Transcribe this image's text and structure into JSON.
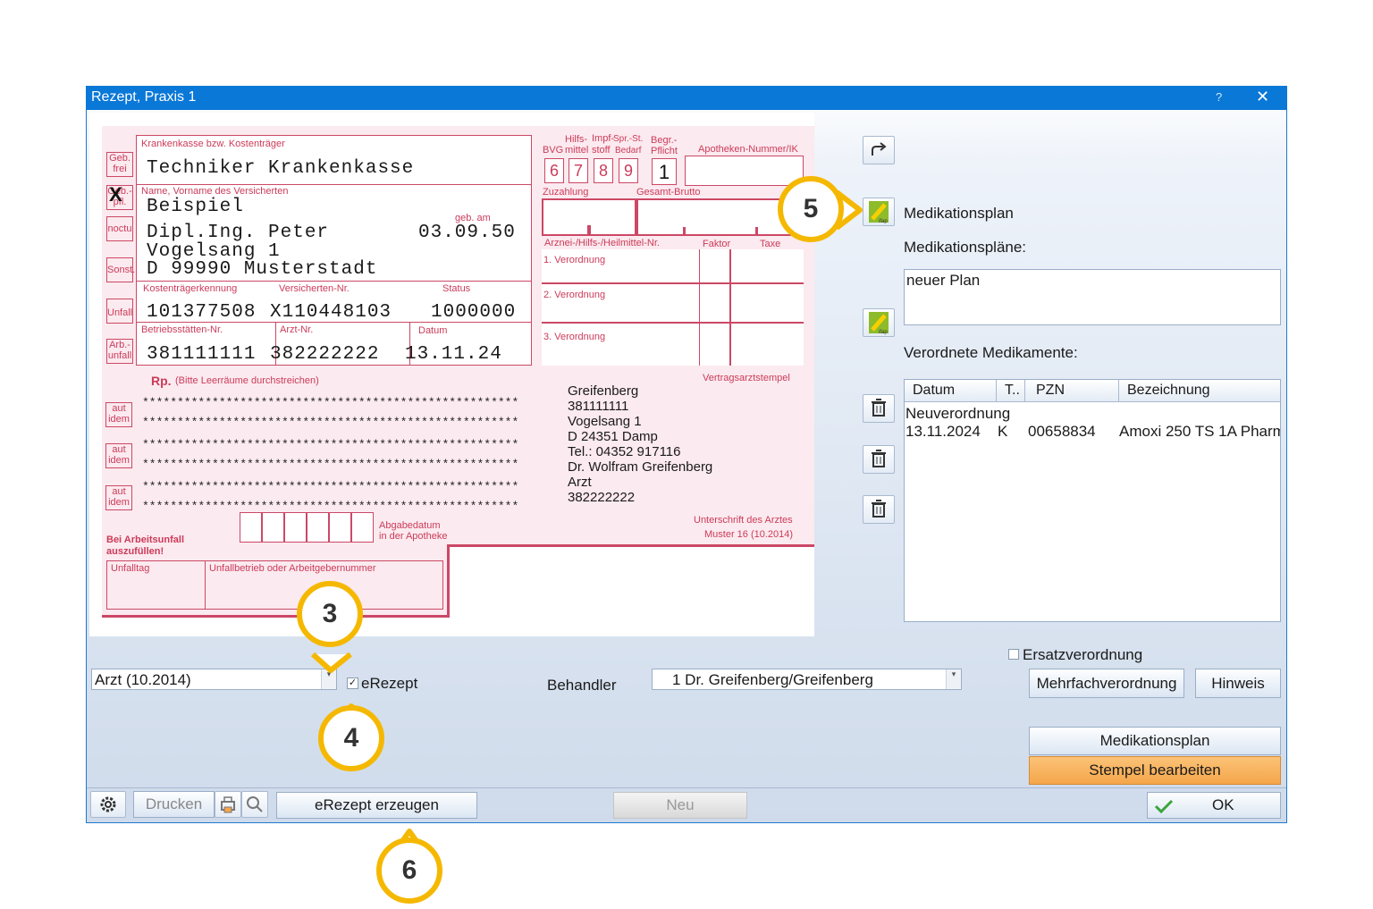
{
  "window": {
    "title": "Rezept, Praxis 1",
    "help": "?",
    "close": "✕"
  },
  "form": {
    "kostentraeger_label": "Krankenkasse bzw. Kostenträger",
    "kostentraeger": "Techniker Krankenkasse",
    "name_label": "Name, Vorname des Versicherten",
    "name_line1": "Beispiel",
    "name_line2": "Dipl.Ing. Peter",
    "street": "Vogelsang 1",
    "city": "D 99990 Musterstadt",
    "geb_label": "geb. am",
    "geb": "03.09.50",
    "kennung_label": "Kostenträgerkennung",
    "kennung": "101377508",
    "versnr_label": "Versicherten-Nr.",
    "versnr": "X110448103",
    "status_label": "Status",
    "status": "1000000",
    "bsnr_label": "Betriebsstätten-Nr.",
    "bsnr": "381111111",
    "arztnr_label": "Arzt-Nr.",
    "arztnr": "382222222",
    "datum_label": "Datum",
    "datum": "13.11.24",
    "side_boxes": [
      "Geb. frei",
      "Geb.-pfl.",
      "noctu",
      "Sonst.",
      "Unfall",
      "Arb.-unfall"
    ],
    "geb_pfl_mark": "X",
    "header_hilfs": "Hilfs-",
    "header_mittel": "mittel",
    "header_impf": "Impf-",
    "header_stoff": "stoff",
    "header_spr": "Spr.-St.",
    "header_bedarf": "Bedarf",
    "header_bvg": "BVG",
    "header_begr": "Begr.-",
    "header_pflicht": "Pflicht",
    "header_apotheken": "Apotheken-Nummer/IK",
    "digits": [
      "6",
      "7",
      "8",
      "9"
    ],
    "begr_value": "1",
    "zuzahlung": "Zuzahlung",
    "gesamt": "Gesamt-Brutto",
    "arznei_label": "Arznei-/Hilfs-/Heilmittel-Nr.",
    "faktor": "Faktor",
    "taxe": "Taxe",
    "verordnung1": "1. Verordnung",
    "verordnung2": "2. Verordnung",
    "verordnung3": "3. Verordnung",
    "rp": "Rp.",
    "rp_hint": "(Bitte Leerräume durchstreichen)",
    "aut_idem": "aut idem",
    "stars": "******************************************************",
    "vertragsarztstempel": "Vertragsarztstempel",
    "stamp_lines": [
      "Greifenberg",
      "381111111",
      "Vogelsang 1",
      "D 24351 Damp",
      "Tel.: 04352 917116",
      "Dr. Wolfram Greifenberg",
      "Arzt",
      "382222222"
    ],
    "abgabedatum": "Abgabedatum",
    "in_apotheke": "in der Apotheke",
    "unterschrift": "Unterschrift des Arztes",
    "muster": "Muster 16 (10.2014)",
    "arbeitsunfall1": "Bei Arbeitsunfall",
    "arbeitsunfall2": "auszufüllen!",
    "unfalltag": "Unfalltag",
    "unfallbetrieb": "Unfallbetrieb oder Arbeitgebernummer"
  },
  "right": {
    "medikationsplan_label": "Medikationsplan",
    "plaene_label": "Medikationspläne:",
    "plaene": [
      "neuer Plan"
    ],
    "verordnete_label": "Verordnete Medikamente:",
    "columns": [
      "Datum",
      "T..",
      "PZN",
      "Bezeichnung"
    ],
    "row_group": "Neuverordnung",
    "rows": [
      {
        "datum": "13.11.2024",
        "t": "K",
        "pzn": "00658834",
        "bez": "Amoxi 250 TS 1A Pharm"
      }
    ],
    "ersatz": "Ersatzverordnung"
  },
  "controls": {
    "formular": "Arzt (10.2014)",
    "erezept": "eRezept",
    "behandler_label": "Behandler",
    "behandler": "1 Dr. Greifenberg/Greifenberg",
    "mehrfach": "Mehrfachverordnung",
    "hinweis": "Hinweis",
    "medplan_btn": "Medikationsplan",
    "stempel": "Stempel bearbeiten",
    "drucken": "Drucken",
    "erezept_erzeugen": "eRezept erzeugen",
    "neu": "Neu",
    "ok": "OK"
  },
  "callouts": [
    "3",
    "4",
    "5",
    "6"
  ],
  "colors": {
    "accent": "#0a78d7",
    "form_red": "#cc3b5a",
    "callout": "#f5b800",
    "stempel_orange": "#f5a64a"
  }
}
